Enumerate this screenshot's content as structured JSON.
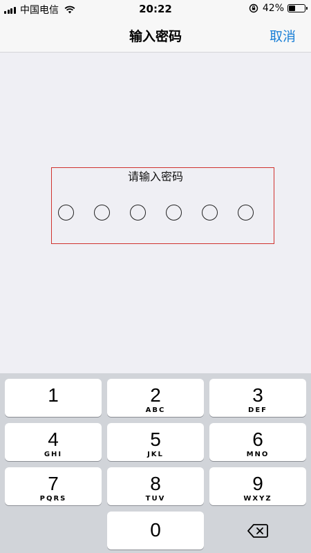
{
  "status": {
    "carrier": "中国电信",
    "time": "20:22",
    "battery_pct": "42%",
    "battery_level": 0.42
  },
  "nav": {
    "title": "输入密码",
    "cancel_label": "取消"
  },
  "main": {
    "prompt": "请输入密码",
    "pin_length": 6
  },
  "keypad": {
    "keys": [
      {
        "num": "1",
        "letters": ""
      },
      {
        "num": "2",
        "letters": "ABC"
      },
      {
        "num": "3",
        "letters": "DEF"
      },
      {
        "num": "4",
        "letters": "GHI"
      },
      {
        "num": "5",
        "letters": "JKL"
      },
      {
        "num": "6",
        "letters": "MNO"
      },
      {
        "num": "7",
        "letters": "PQRS"
      },
      {
        "num": "8",
        "letters": "TUV"
      },
      {
        "num": "9",
        "letters": "WXYZ"
      },
      {
        "num": "0",
        "letters": ""
      }
    ],
    "delete_icon": "backspace-icon"
  },
  "colors": {
    "accent": "#1a7fd6",
    "highlight_border": "#d0312d",
    "keypad_bg": "#d1d4d9"
  }
}
